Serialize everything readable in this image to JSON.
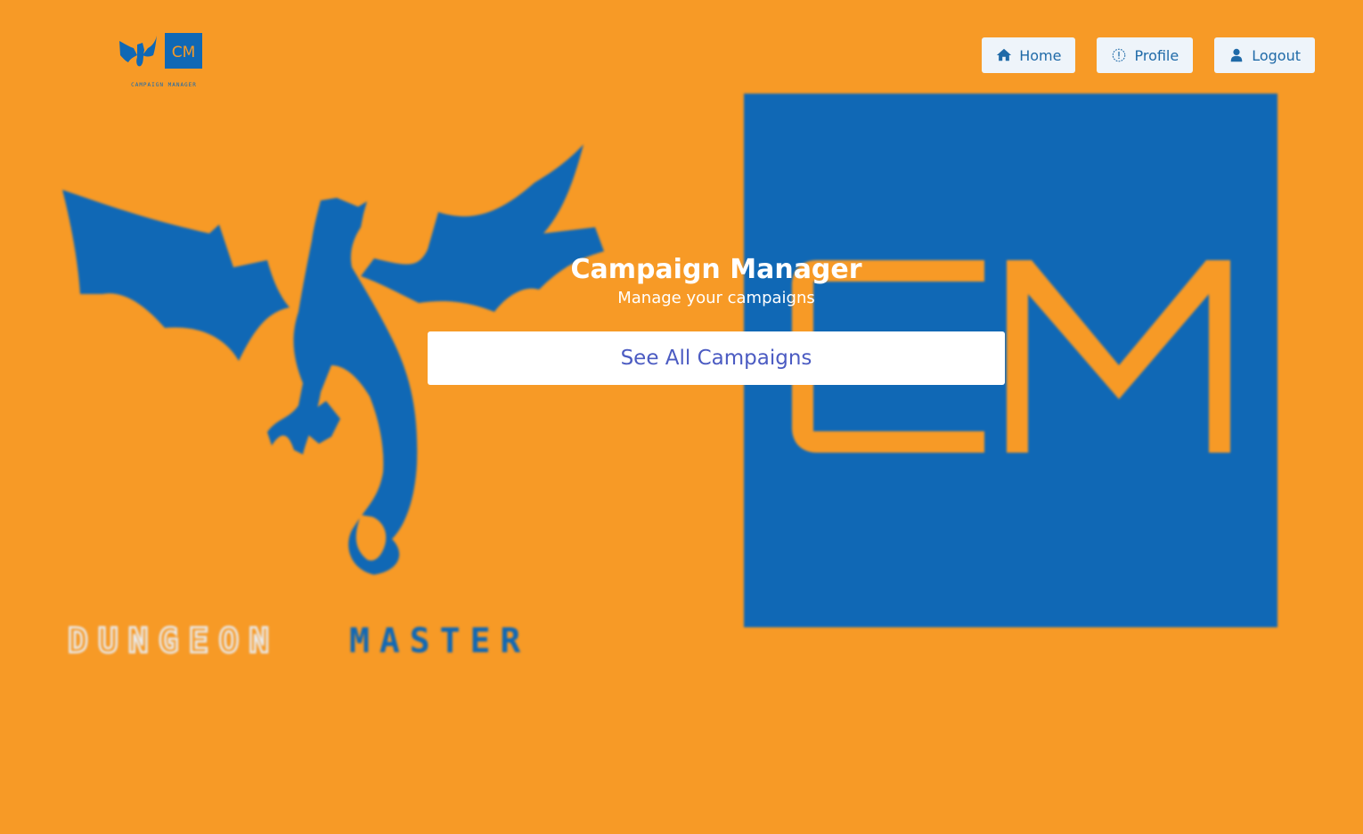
{
  "colors": {
    "background": "#F79A26",
    "brand_blue": "#1068B5",
    "nav_button_bg": "#EEF4FA",
    "nav_text": "#1F6AA8",
    "hero_button_text": "#4B5BC2",
    "logo_text_light": "#E8EEF6"
  },
  "header": {
    "logo_cm_text": "CM",
    "logo_caption": "CAMPAIGN MANAGER",
    "nav": [
      {
        "label": "Home",
        "icon": "home-icon"
      },
      {
        "label": "Profile",
        "icon": "info-circle-icon"
      },
      {
        "label": "Logout",
        "icon": "user-icon"
      }
    ]
  },
  "hero": {
    "title": "Campaign Manager",
    "subtitle": "Manage your campaigns",
    "button_label": "See All Campaigns"
  },
  "background_art": {
    "cm_text": "CM",
    "dungeon_text": "DUNGEON",
    "master_text": "MASTER"
  }
}
